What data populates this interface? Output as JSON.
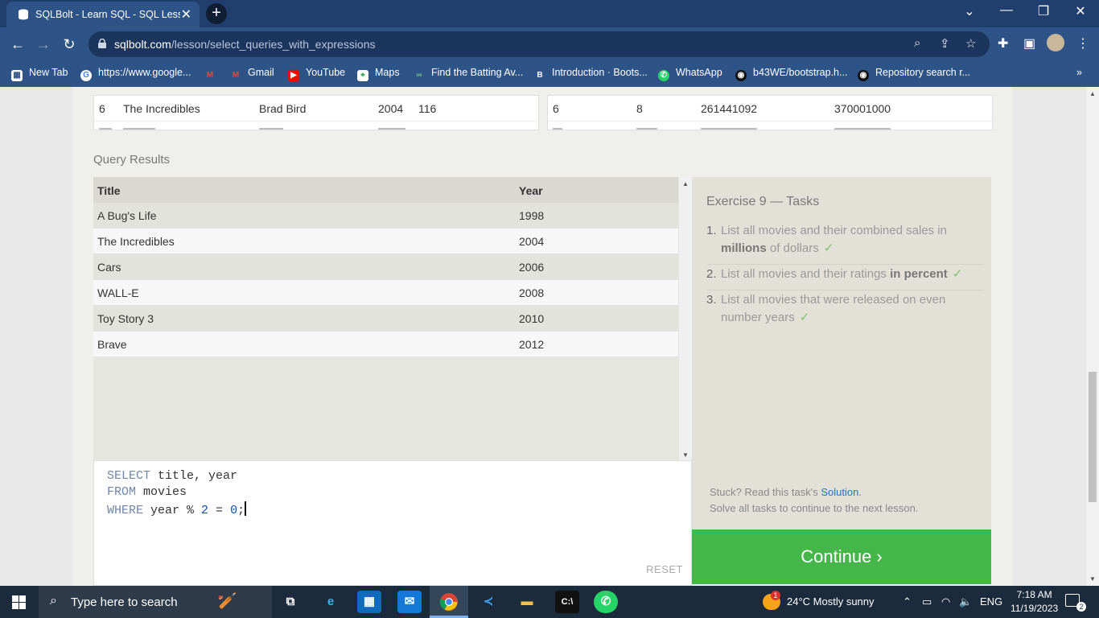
{
  "browser": {
    "tab_title": "SQLBolt - Learn SQL - SQL Lesso",
    "new_tab_symbol": "+",
    "url_host": "sqlbolt.com",
    "url_path": "/lesson/select_queries_with_expressions",
    "bookmarks": [
      {
        "label": "New Tab",
        "icon": "grid-icon"
      },
      {
        "label": "https://www.google...",
        "icon": "google-icon"
      },
      {
        "label": "",
        "icon": "gmail-icon"
      },
      {
        "label": "Gmail",
        "icon": "gmail-icon"
      },
      {
        "label": "YouTube",
        "icon": "youtube-icon"
      },
      {
        "label": "Maps",
        "icon": "maps-icon"
      },
      {
        "label": "Find the Batting Av...",
        "icon": "link-icon"
      },
      {
        "label": "Introduction · Boots...",
        "icon": "bootstrap-icon"
      },
      {
        "label": "WhatsApp",
        "icon": "whatsapp-icon"
      },
      {
        "label": "b43WE/bootstrap.h...",
        "icon": "github-icon"
      },
      {
        "label": "Repository search r...",
        "icon": "github-icon"
      }
    ]
  },
  "top_table_left": {
    "cells": [
      "6",
      "The Incredibles",
      "Brad Bird",
      "2004",
      "116"
    ]
  },
  "top_table_right": {
    "cells": [
      "6",
      "8",
      "261441092",
      "370001000"
    ]
  },
  "results": {
    "label": "Query Results",
    "columns": [
      "Title",
      "Year"
    ],
    "rows": [
      {
        "title": "A Bug's Life",
        "year": "1998"
      },
      {
        "title": "The Incredibles",
        "year": "2004"
      },
      {
        "title": "Cars",
        "year": "2006"
      },
      {
        "title": "WALL-E",
        "year": "2008"
      },
      {
        "title": "Toy Story 3",
        "year": "2010"
      },
      {
        "title": "Brave",
        "year": "2012"
      }
    ]
  },
  "editor": {
    "line1_kw": "SELECT",
    "line1_rest": " title, year",
    "line2_kw": "FROM",
    "line2_rest": " movies",
    "line3_kw": "WHERE",
    "line3_mid": " year % ",
    "line3_num1": "2",
    "line3_eq": " = ",
    "line3_num2": "0",
    "line3_end": ";",
    "reset_label": "RESET"
  },
  "tasks": {
    "heading": "Exercise 9 — Tasks",
    "items": [
      {
        "num": "1.",
        "pre": "List all movies and their combined sales in ",
        "bold": "millions",
        "post": " of dollars",
        "done": "✓"
      },
      {
        "num": "2.",
        "pre": "List all movies and their ratings ",
        "bold": "in percent",
        "post": "",
        "done": "✓"
      },
      {
        "num": "3.",
        "pre": "List all movies that were released on even number years",
        "bold": "",
        "post": "",
        "done": "✓"
      }
    ],
    "stuck_pre": "Stuck? Read this task's ",
    "stuck_link": "Solution",
    "stuck_post": ".",
    "solve_all": "Solve all tasks to continue to the next lesson.",
    "continue_label": "Continue ›"
  },
  "taskbar": {
    "search_placeholder": "Type here to search",
    "weather": "24°C  Mostly sunny",
    "weather_badge": "1",
    "lang": "ENG",
    "time": "7:18 AM",
    "date": "11/19/2023",
    "notif_count": "2"
  },
  "colors": {
    "chrome_dark": "#203f6e",
    "chrome": "#2e5487",
    "continue_green": "#45b649",
    "taskbar": "#1c2b3c"
  }
}
